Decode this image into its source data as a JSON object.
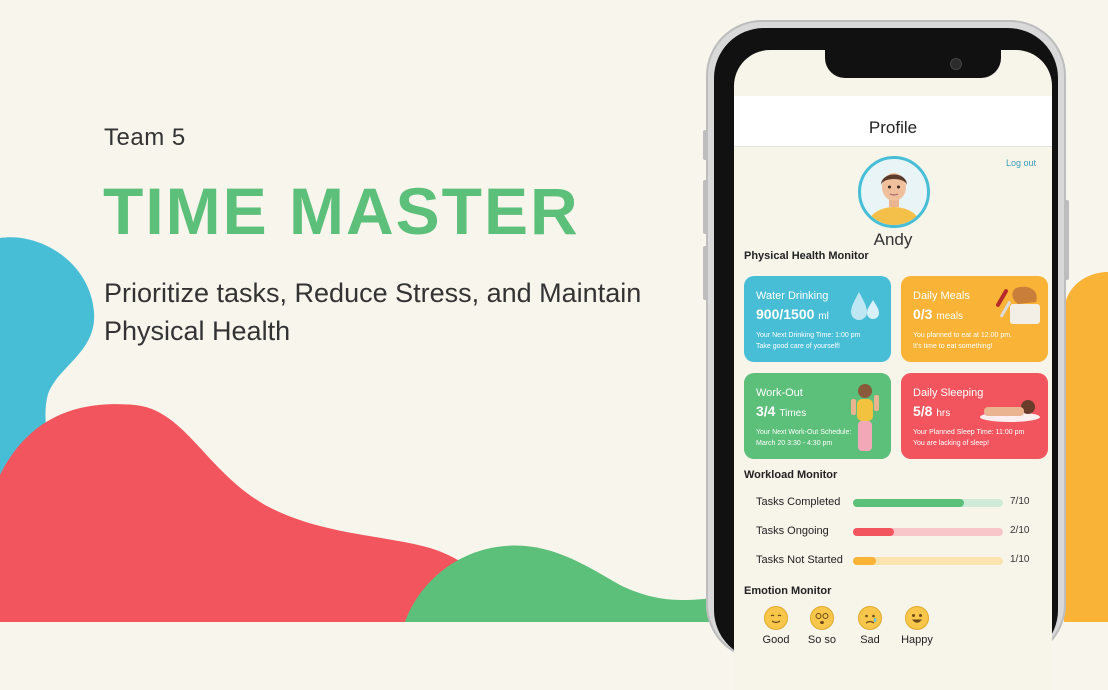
{
  "slide": {
    "team": "Team 5",
    "title": "TIME MASTER",
    "subtitle": "Prioritize tasks, Reduce Stress, and Maintain Physical Health"
  },
  "colors": {
    "green": "#5cbf7a",
    "blue": "#48bed6",
    "orange": "#f9b336",
    "red": "#f2555e",
    "bg": "#f8f5ec"
  },
  "app": {
    "page_title": "Profile",
    "logout_label": "Log out",
    "username": "Andy",
    "physical_section": "Physical Health Monitor",
    "cards": {
      "water": {
        "title": "Water Drinking",
        "value": "900/1500",
        "unit": "ml",
        "note1": "Your Next Drinking Time: 1:00 pm",
        "note2": "Take good care of yourself!",
        "icon": "water-drops-icon"
      },
      "meals": {
        "title": "Daily Meals",
        "value": "0/3",
        "unit": "meals",
        "note1": "You planned to eat at 12.00 pm.",
        "note2": "It's time to eat something!",
        "icon": "bread-knife-icon"
      },
      "workout": {
        "title": "Work-Out",
        "value": "3/4",
        "unit": "Times",
        "note1": "Your Next Work-Out Schedule:",
        "note2": "March 20  3:30 - 4:30 pm",
        "icon": "workout-person-icon"
      },
      "sleep": {
        "title": "Daily Sleeping",
        "value": "5/8",
        "unit": "hrs",
        "note1": "Your Planned Sleep Time: 11:00 pm",
        "note2": "You are lacking of sleep!",
        "icon": "sleeping-person-icon"
      }
    },
    "workload_section": "Workload Monitor",
    "workload": [
      {
        "label": "Tasks Completed",
        "count": "7/10",
        "progress": 0.74
      },
      {
        "label": "Tasks Ongoing",
        "count": "2/10",
        "progress": 0.27
      },
      {
        "label": "Tasks Not Started",
        "count": "1/10",
        "progress": 0.15
      }
    ],
    "emotion_section": "Emotion Monitor",
    "emotions": [
      {
        "label": "Good",
        "icon": "smiling-face-icon"
      },
      {
        "label": "So so",
        "icon": "dizzy-face-icon"
      },
      {
        "label": "Sad",
        "icon": "crying-face-icon"
      },
      {
        "label": "Happy",
        "icon": "grinning-face-icon"
      }
    ]
  }
}
